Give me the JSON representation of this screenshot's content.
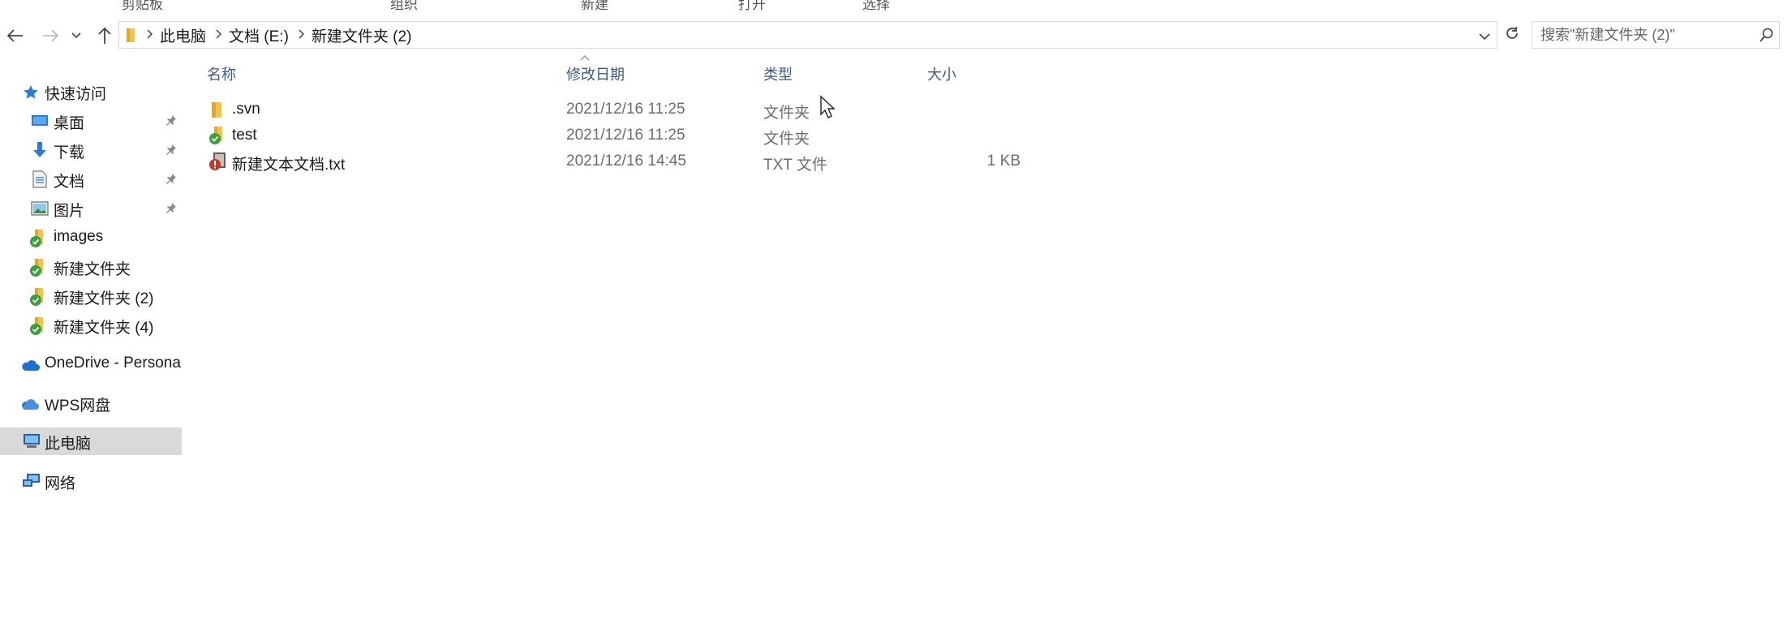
{
  "ribbon": {
    "labels": [
      "剪贴板",
      "组织",
      "新建",
      "打开",
      "选择"
    ]
  },
  "navigation": {
    "back_icon": "arrow-left-icon",
    "forward_icon": "arrow-right-icon",
    "recent_icon": "chevron-down-icon",
    "up_icon": "arrow-up-icon"
  },
  "address_bar": {
    "breadcrumbs": [
      "此电脑",
      "文档 (E:)",
      "新建文件夹 (2)"
    ],
    "dropdown_icon": "chevron-down-icon",
    "refresh_icon": "refresh-icon"
  },
  "search": {
    "placeholder": "搜索\"新建文件夹 (2)\"",
    "icon": "search-icon"
  },
  "sidebar": {
    "quick_access": "快速访问",
    "items": [
      {
        "label": "桌面",
        "icon": "desktop-icon",
        "pinned": true
      },
      {
        "label": "下载",
        "icon": "download-icon",
        "pinned": true
      },
      {
        "label": "文档",
        "icon": "document-icon",
        "pinned": true
      },
      {
        "label": "图片",
        "icon": "pictures-icon",
        "pinned": true
      },
      {
        "label": "images",
        "icon": "svn-folder-icon",
        "pinned": false
      },
      {
        "label": "新建文件夹",
        "icon": "svn-folder-icon",
        "pinned": false
      },
      {
        "label": "新建文件夹 (2)",
        "icon": "svn-folder-icon",
        "pinned": false
      },
      {
        "label": "新建文件夹 (4)",
        "icon": "svn-folder-icon",
        "pinned": false
      }
    ],
    "onedrive": "OneDrive - Personal",
    "wps": "WPS网盘",
    "this_pc": "此电脑",
    "network": "网络"
  },
  "columns": {
    "name": "名称",
    "date": "修改日期",
    "type": "类型",
    "size": "大小"
  },
  "files": [
    {
      "name": ".svn",
      "date": "2021/12/16 11:25",
      "type": "文件夹",
      "size": "",
      "icon": "folder-icon"
    },
    {
      "name": "test",
      "date": "2021/12/16 11:25",
      "type": "文件夹",
      "size": "",
      "icon": "svn-folder-icon"
    },
    {
      "name": "新建文本文档.txt",
      "date": "2021/12/16 14:45",
      "type": "TXT 文件",
      "size": "1 KB",
      "icon": "svn-modified-text-file-icon"
    }
  ],
  "colors": {
    "header_text": "#3b5c8a",
    "selected_bg": "#d9d9d9",
    "folder": "#f3c24d",
    "svn_check": "#3aa13a",
    "svn_warning": "#c0392b"
  }
}
